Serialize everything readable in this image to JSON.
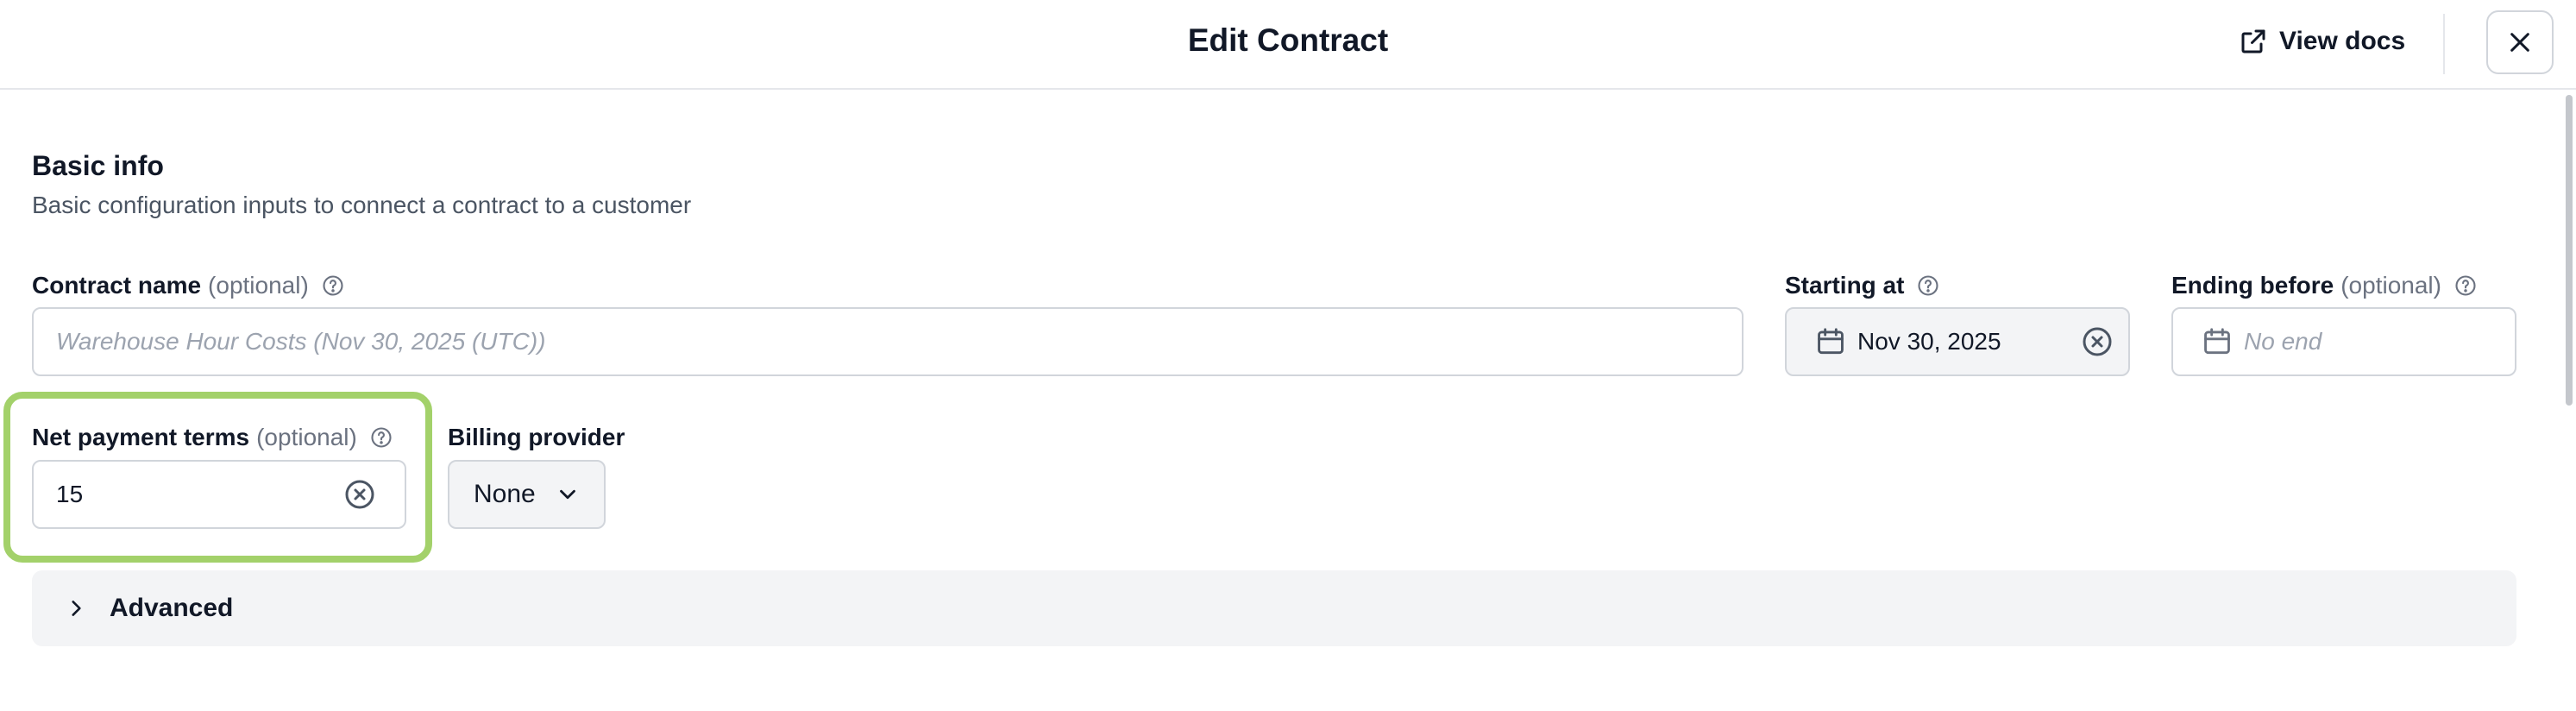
{
  "header": {
    "title": "Edit Contract",
    "docs_label": "View docs"
  },
  "basic_info": {
    "title": "Basic info",
    "subtitle": "Basic configuration inputs to connect a contract to a customer"
  },
  "contract_name": {
    "label": "Contract name",
    "optional": "(optional)",
    "placeholder": "Warehouse Hour Costs (Nov 30, 2025 (UTC))",
    "value": ""
  },
  "starting_at": {
    "label": "Starting at",
    "value": "Nov 30, 2025"
  },
  "ending_before": {
    "label": "Ending before",
    "optional": "(optional)",
    "placeholder": "No end"
  },
  "net_payment_terms": {
    "label": "Net payment terms",
    "optional": "(optional)",
    "value": "15"
  },
  "billing_provider": {
    "label": "Billing provider",
    "selected": "None"
  },
  "advanced": {
    "label": "Advanced"
  },
  "colors": {
    "highlight": "#a3d16a",
    "text": "#111827",
    "muted": "#6b7280",
    "field_gray": "#f3f4f6"
  },
  "icons": [
    "external-link-icon",
    "close-icon",
    "help-icon",
    "calendar-icon",
    "clear-icon",
    "chevron-down-icon",
    "chevron-right-icon"
  ]
}
